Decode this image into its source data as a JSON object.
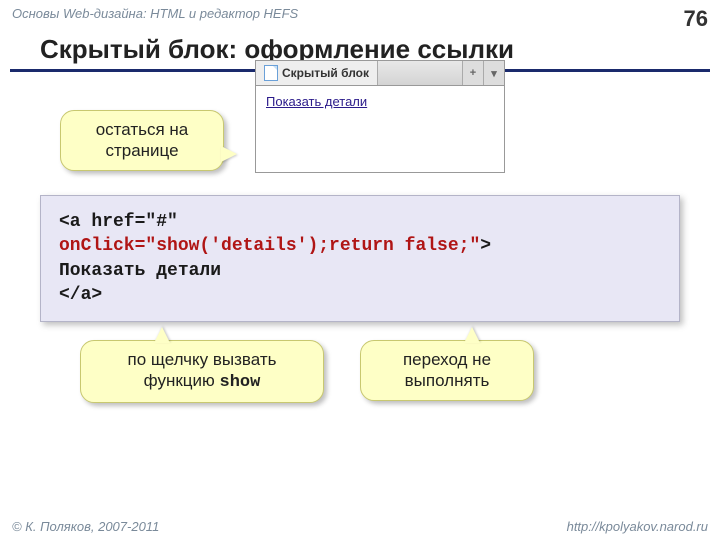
{
  "header": {
    "topline": "Основы Web-дизайна: HTML и редактор HEFS",
    "page_number": "76",
    "title": "Скрытый блок: оформление ссылки"
  },
  "browser": {
    "tab_title": "Скрытый блок",
    "btn_plus": "+",
    "btn_down": "▾",
    "link_text": "Показать детали"
  },
  "callouts": {
    "stay": {
      "line1": "остаться на",
      "line2": "странице"
    },
    "show": {
      "line1": "по щелчку вызвать",
      "line2_prefix": "функцию ",
      "line2_mono": "show"
    },
    "noop": {
      "line1": "переход не",
      "line2": "выполнять"
    }
  },
  "code": {
    "l1": "<a href=\"#\"",
    "l2_indent": "   ",
    "l2_red": "onClick=\"show('details');return false;\"",
    "l2_end": ">",
    "l3": "Показать детали",
    "l4": "</a>"
  },
  "footer": {
    "copyright": "© К. Поляков, 2007-2011",
    "url": "http://kpolyakov.narod.ru"
  }
}
